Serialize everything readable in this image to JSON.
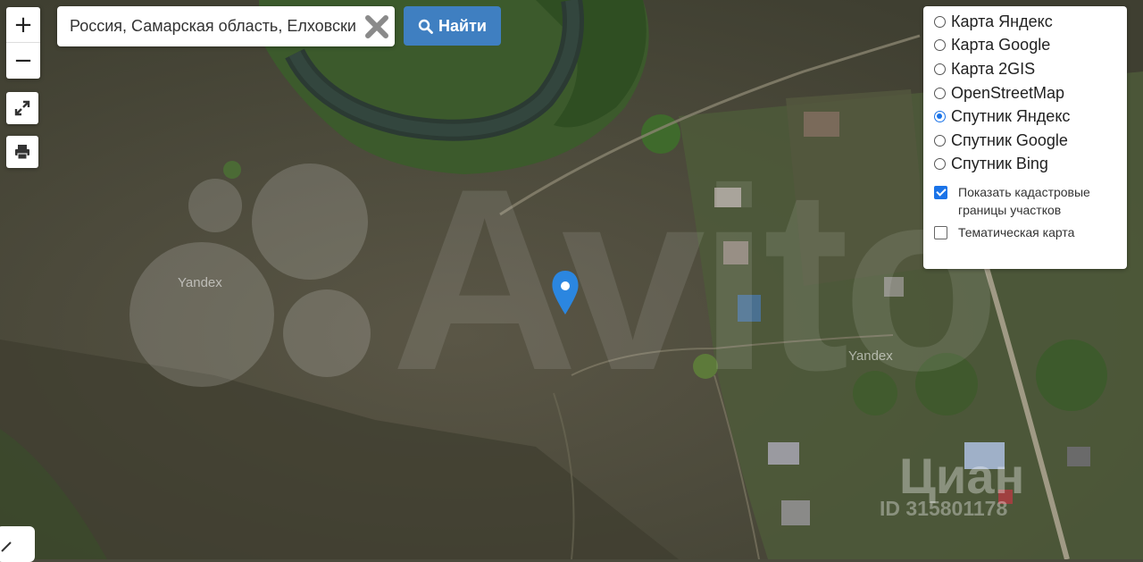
{
  "map": {
    "provider_label_left": "Yandex",
    "provider_label_right": "Yandex",
    "watermark_avito": "Avito",
    "watermark_cian": "Циан",
    "watermark_cian_id": "ID 315801178"
  },
  "controls": {
    "zoom_in": "+",
    "zoom_out": "−"
  },
  "search": {
    "value": "Россия, Самарская область, Елховский",
    "button_label": "Найти"
  },
  "layers": {
    "options": [
      {
        "label": "Карта Яндекс",
        "selected": false
      },
      {
        "label": "Карта Google",
        "selected": false
      },
      {
        "label": "Карта 2GIS",
        "selected": false
      },
      {
        "label": "OpenStreetMap",
        "selected": false
      },
      {
        "label": "Спутник Яндекс",
        "selected": true
      },
      {
        "label": "Спутник Google",
        "selected": false
      },
      {
        "label": "Спутник Bing",
        "selected": false
      }
    ],
    "cadastral_label": "Показать кадастровые границы участков",
    "cadastral_checked": true,
    "thematic_label": "Тематическая карта",
    "thematic_checked": false
  },
  "colors": {
    "marker": "#2b86e0",
    "button": "#3f7fc1",
    "radio_accent": "#1a73e8"
  }
}
